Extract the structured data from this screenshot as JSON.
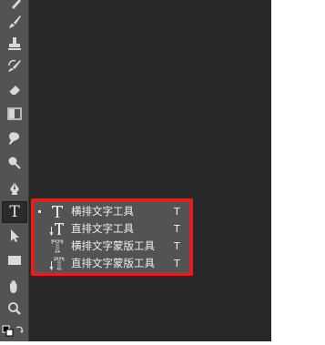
{
  "toolbar": {
    "icons": [
      "brush-partial-icon",
      "brush-icon",
      "clone-stamp-icon",
      "history-brush-icon",
      "eraser-icon",
      "gradient-icon",
      "blur-icon",
      "dodge-icon",
      "pen-icon",
      "type-icon",
      "path-selection-icon",
      "rectangle-shape-icon",
      "hand-icon",
      "zoom-icon",
      "color-swatches-icon"
    ],
    "active_tool": "type-icon",
    "type_tool_glyph": "T"
  },
  "flyout": {
    "border_color": "#e0201f",
    "items": [
      {
        "label": "横排文字工具",
        "shortcut": "T",
        "icon": "horizontal-type-icon",
        "selected": true
      },
      {
        "label": "直排文字工具",
        "shortcut": "T",
        "icon": "vertical-type-icon",
        "selected": false
      },
      {
        "label": "横排文字蒙版工具",
        "shortcut": "T",
        "icon": "horizontal-type-mask-icon",
        "selected": false
      },
      {
        "label": "直排文字蒙版工具",
        "shortcut": "T",
        "icon": "vertical-type-mask-icon",
        "selected": false
      }
    ]
  }
}
